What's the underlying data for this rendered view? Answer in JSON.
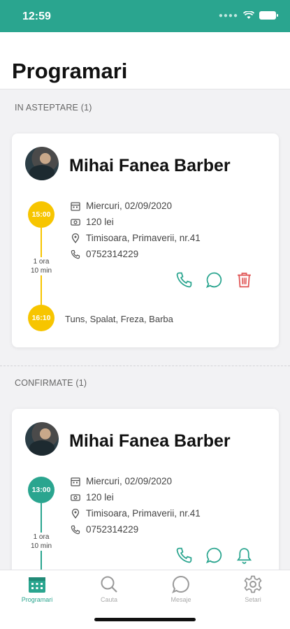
{
  "status_bar": {
    "time": "12:59",
    "icons": [
      "signal-icon",
      "wifi-icon",
      "battery-icon"
    ]
  },
  "header": {
    "title": "Programari"
  },
  "sections": [
    {
      "label": "IN ASTEPTARE (1)",
      "card": {
        "provider": "Mihai Fanea Barber",
        "start_time": "15:00",
        "end_time": "16:10",
        "duration_line1": "1 ora",
        "duration_line2": "10 min",
        "date": "Miercuri, 02/09/2020",
        "price": "120 lei",
        "address": "Timisoara, Primaverii, nr.41",
        "phone": "0752314229",
        "services": "Tuns, Spalat, Freza, Barba",
        "actions": [
          "phone-icon",
          "message-icon",
          "trash-icon"
        ]
      }
    },
    {
      "label": "CONFIRMATE (1)",
      "card": {
        "provider": "Mihai Fanea Barber",
        "start_time": "13:00",
        "duration_line1": "1 ora",
        "duration_line2": "10 min",
        "date": "Miercuri, 02/09/2020",
        "price": "120 lei",
        "address": "Timisoara, Primaverii, nr.41",
        "phone": "0752314229",
        "actions": [
          "phone-icon",
          "message-icon",
          "bell-icon"
        ]
      }
    }
  ],
  "nav": {
    "items": [
      {
        "label": "Programari",
        "icon": "calendar-icon",
        "active": true
      },
      {
        "label": "Cauta",
        "icon": "search-icon",
        "active": false
      },
      {
        "label": "Mesaje",
        "icon": "chat-icon",
        "active": false
      },
      {
        "label": "Setari",
        "icon": "gear-icon",
        "active": false
      }
    ]
  },
  "colors": {
    "accent": "#2aa58f",
    "pending": "#f7c500",
    "danger": "#e05555"
  }
}
